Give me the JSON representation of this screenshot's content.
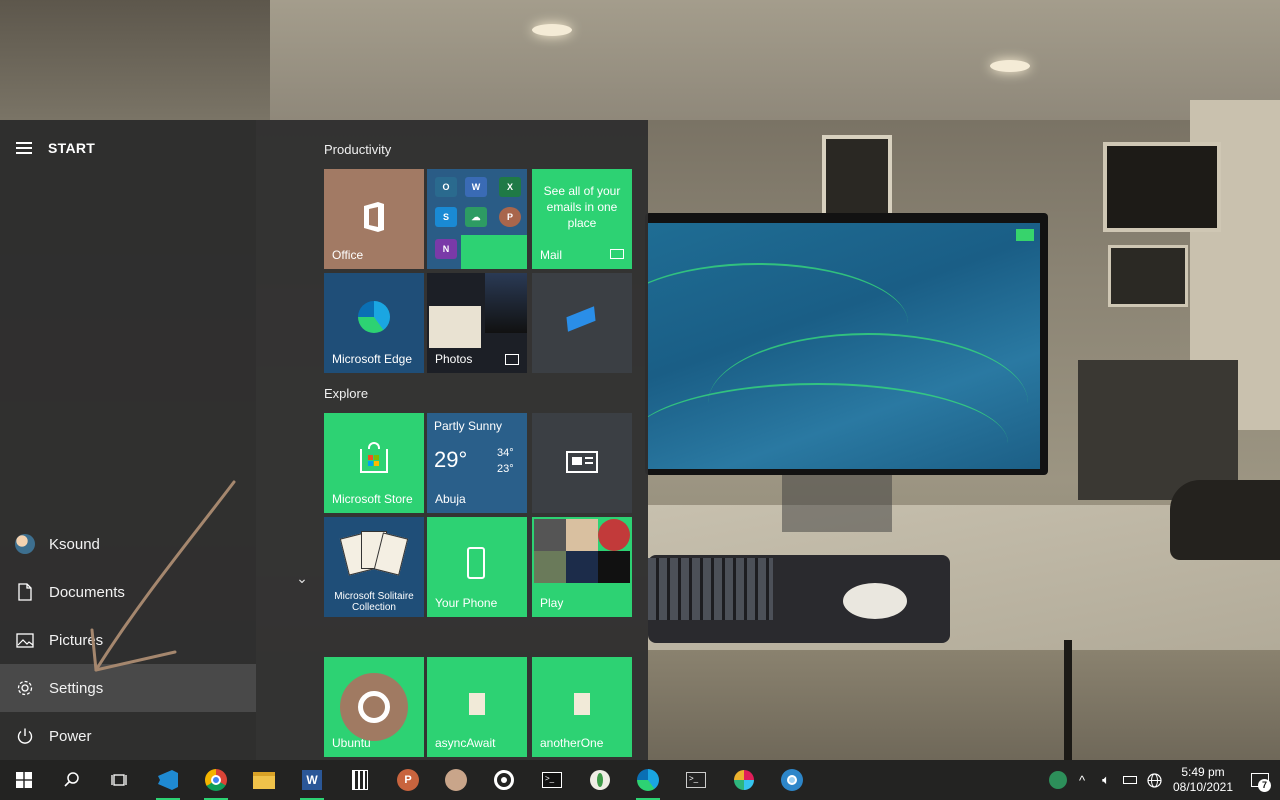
{
  "start_menu": {
    "title": "START",
    "rail": {
      "user": "Ksound",
      "items": [
        {
          "label": "Documents",
          "icon": "document-icon"
        },
        {
          "label": "Pictures",
          "icon": "pictures-icon"
        },
        {
          "label": "Settings",
          "icon": "gear-icon",
          "active": true
        },
        {
          "label": "Power",
          "icon": "power-icon"
        }
      ]
    },
    "groups": {
      "productivity": "Productivity",
      "explore": "Explore"
    },
    "tiles": {
      "office": "Office",
      "mail_label": "Mail",
      "mail_message": "See all of your emails in one place",
      "edge": "Microsoft Edge",
      "photos": "Photos",
      "store": "Microsoft Store",
      "weather": {
        "condition": "Partly Sunny",
        "temp": "29°",
        "high": "34°",
        "low": "23°",
        "city": "Abuja"
      },
      "solitaire": "Microsoft Solitaire Collection",
      "phone": "Your Phone",
      "play": "Play",
      "ubuntu": "Ubuntu",
      "async": "asyncAwait",
      "another": "anotherOne"
    }
  },
  "taskbar": {
    "apps": [
      "windows-start",
      "search",
      "task-view",
      "vscode",
      "chrome",
      "file-explorer",
      "word",
      "calculator",
      "powerpoint",
      "pen-app",
      "groove",
      "terminal",
      "mongodb",
      "edge",
      "powershell",
      "slack",
      "chromium"
    ],
    "clock_time": "5:49 pm",
    "clock_date": "08/10/2021",
    "notification_count": "7"
  },
  "colors": {
    "accent": "#2dd273",
    "office_tile": "#a27a64",
    "weather_tile": "#2a5f8a"
  }
}
